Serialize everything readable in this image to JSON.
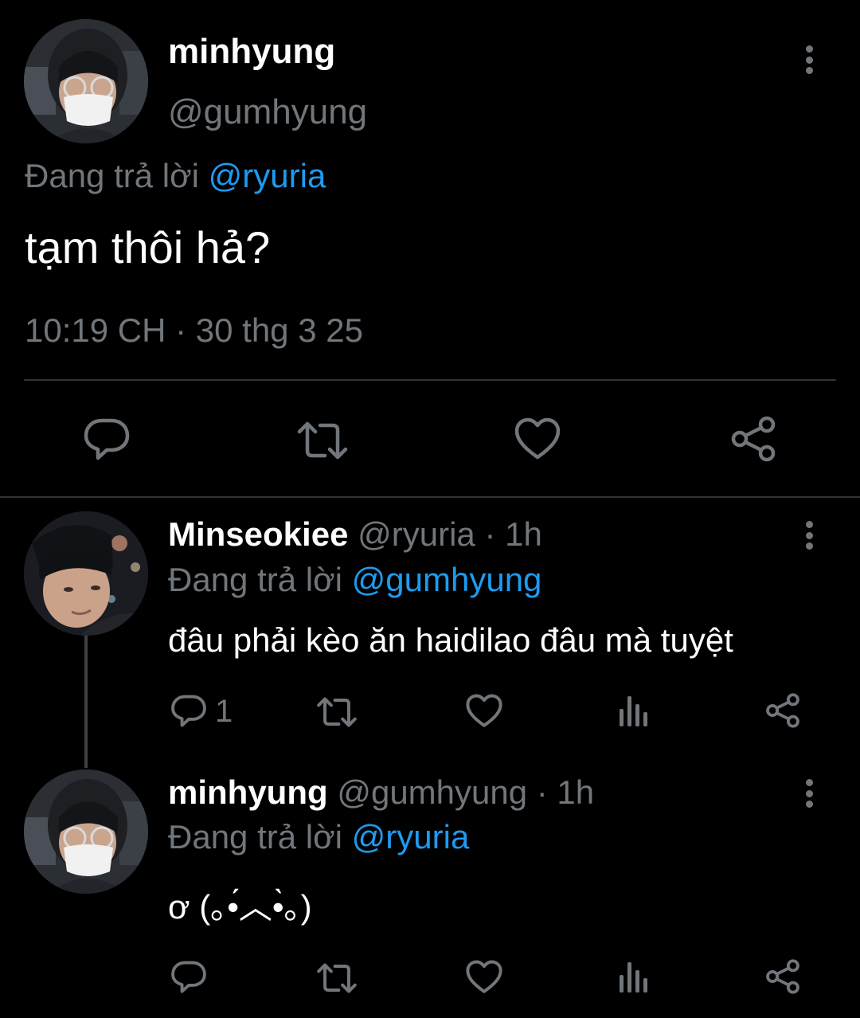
{
  "main_tweet": {
    "display_name": "minhyung",
    "handle": "@gumhyung",
    "reply_prefix": "Đang trả lời",
    "reply_to": "@ryuria",
    "text": "tạm thôi hả?",
    "timestamp": "10:19 CH · 30 thg 3 25"
  },
  "replies": [
    {
      "display_name": "Minseokiee",
      "handle": "@ryuria",
      "time": "· 1h",
      "reply_prefix": "Đang trả lời",
      "reply_to": "@gumhyung",
      "text": "đâu phải kèo ăn haidilao đâu mà tuyệt",
      "reply_count": "1"
    },
    {
      "display_name": "minhyung",
      "handle": "@gumhyung",
      "time": "· 1h",
      "reply_prefix": "Đang trả lời",
      "reply_to": "@ryuria",
      "text": "ơ (｡•́︿•̀｡)",
      "reply_count": ""
    }
  ],
  "icons": {
    "reply": "reply-icon",
    "retweet": "retweet-icon",
    "like": "heart-icon",
    "share": "share-icon",
    "views": "views-icon",
    "more": "more-options-icon"
  },
  "colors": {
    "background": "#000000",
    "text": "#ffffff",
    "muted": "#71767b",
    "link": "#1d9bf0",
    "divider": "#2f3336"
  }
}
